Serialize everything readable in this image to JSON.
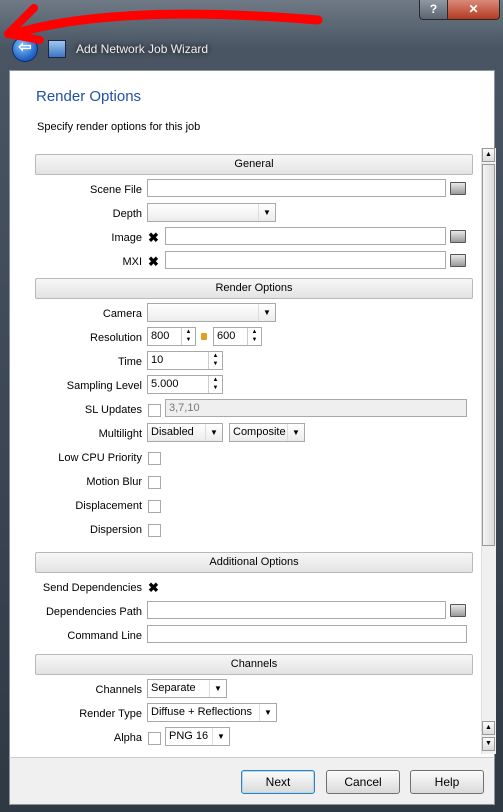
{
  "window": {
    "title": "Add Network Job Wizard",
    "help_glyph": "?",
    "close_glyph": "✕",
    "back_glyph": "⇦"
  },
  "page": {
    "heading": "Render Options",
    "subtitle": "Specify render options for this job"
  },
  "sections": {
    "general": "General",
    "render_options": "Render Options",
    "additional": "Additional Options",
    "channels": "Channels"
  },
  "general": {
    "scene_file_label": "Scene File",
    "scene_file_value": "",
    "depth_label": "Depth",
    "depth_value": "",
    "image_label": "Image",
    "image_checked": "✖",
    "image_value": "",
    "mxi_label": "MXI",
    "mxi_checked": "✖",
    "mxi_value": ""
  },
  "render": {
    "camera_label": "Camera",
    "camera_value": "",
    "resolution_label": "Resolution",
    "res_width": "800",
    "res_height": "600",
    "time_label": "Time",
    "time_value": "10",
    "sampling_label": "Sampling Level",
    "sampling_value": "5.000",
    "sl_updates_label": "SL Updates",
    "sl_updates_value": "3,7,10",
    "multilight_label": "Multilight",
    "multilight_value": "Disabled",
    "multilight_mode": "Composite",
    "low_cpu_label": "Low CPU Priority",
    "motion_blur_label": "Motion Blur",
    "displacement_label": "Displacement",
    "dispersion_label": "Dispersion"
  },
  "additional": {
    "send_deps_label": "Send Dependencies",
    "send_deps_checked": "✖",
    "deps_path_label": "Dependencies Path",
    "deps_path_value": "",
    "command_line_label": "Command Line",
    "command_line_value": ""
  },
  "channels": {
    "channels_label": "Channels",
    "channels_value": "Separate",
    "render_type_label": "Render Type",
    "render_type_value": "Diffuse + Reflections",
    "alpha_label": "Alpha",
    "alpha_format": "PNG 16"
  },
  "buttons": {
    "next": "Next",
    "cancel": "Cancel",
    "help": "Help"
  },
  "icons": {
    "dropdown": "▼",
    "spin": "▲\n▼",
    "scroll_up": "▲",
    "scroll_down": "▼"
  },
  "colors": {
    "heading": "#2051a8",
    "annotation_arrow": "#ff0000"
  }
}
